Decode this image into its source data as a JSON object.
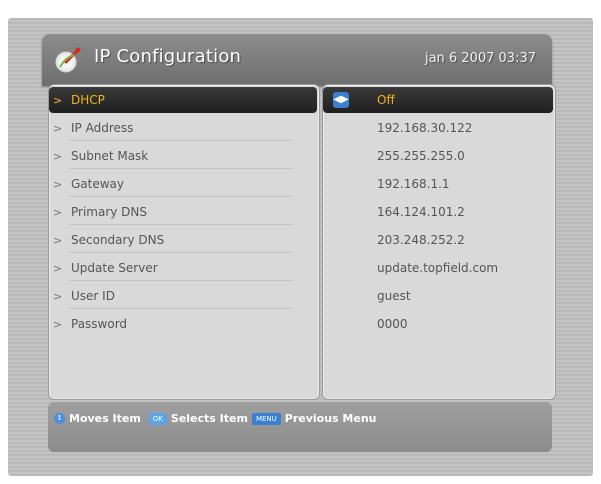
{
  "header": {
    "title": "IP Configuration",
    "datetime": "jan 6 2007 03:37",
    "icon": "satellite-dish-icon"
  },
  "settings": [
    {
      "label": "DHCP",
      "value": "Off",
      "selected": true
    },
    {
      "label": "IP Address",
      "value": "192.168.30.122"
    },
    {
      "label": "Subnet Mask",
      "value": "255.255.255.0"
    },
    {
      "label": "Gateway",
      "value": "192.168.1.1"
    },
    {
      "label": "Primary DNS",
      "value": "164.124.101.2"
    },
    {
      "label": "Secondary DNS",
      "value": "203.248.252.2"
    },
    {
      "label": "Update Server",
      "value": "update.topfield.com"
    },
    {
      "label": "User ID",
      "value": "guest"
    },
    {
      "label": "Password",
      "value": "0000"
    }
  ],
  "footer": {
    "move_text": "Moves Item",
    "ok_key": "OK",
    "select_text": "Selects Item",
    "menu_key": "MENU",
    "menu_text": "Previous Menu"
  },
  "colors": {
    "highlight_text": "#f2b318",
    "selected_bg": "#2a2a2a",
    "panel_bg": "#d9d9d9",
    "key_blue": "#5aa5e8"
  }
}
